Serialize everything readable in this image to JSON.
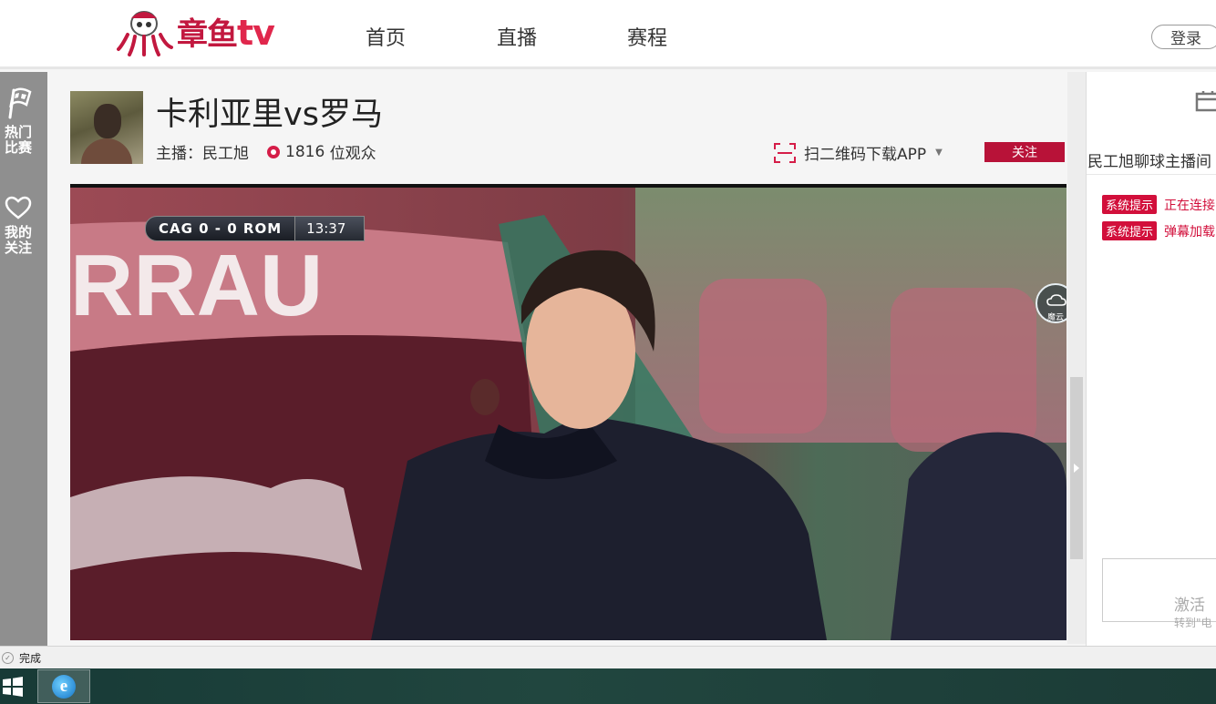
{
  "header": {
    "logo_text": "章鱼",
    "logo_tv": "tv",
    "nav": [
      "首页",
      "直播",
      "赛程"
    ],
    "login_label": "登录"
  },
  "sidebar": {
    "items": [
      {
        "label": "热门比赛",
        "icon": "flag-icon"
      },
      {
        "label": "我的关注",
        "icon": "heart-icon"
      }
    ]
  },
  "room": {
    "title": "卡利亚里vs罗马",
    "host_label": "主播：民工旭",
    "viewer_count": "1816",
    "viewer_suffix": "位观众",
    "qr_label": "扫二维码下载APP",
    "follow_label": "关注"
  },
  "video": {
    "score_teams": "CAG 0 - 0 ROM",
    "score_time": "13:37",
    "banner_text": "RRAU",
    "watermark_label": "魔云"
  },
  "chat": {
    "icon": "mobile-icon",
    "title": "民工旭聊球主播间",
    "messages": [
      {
        "tag": "系统提示",
        "text": "正在连接"
      },
      {
        "tag": "系统提示",
        "text": "弹幕加载"
      }
    ],
    "activate_text": "激活",
    "activate_sub": "转到\"电"
  },
  "statusbar": {
    "text": "完成"
  },
  "colors": {
    "brand": "#c2183f",
    "follow_button": "#b81238",
    "system_tag": "#d20f3b"
  }
}
